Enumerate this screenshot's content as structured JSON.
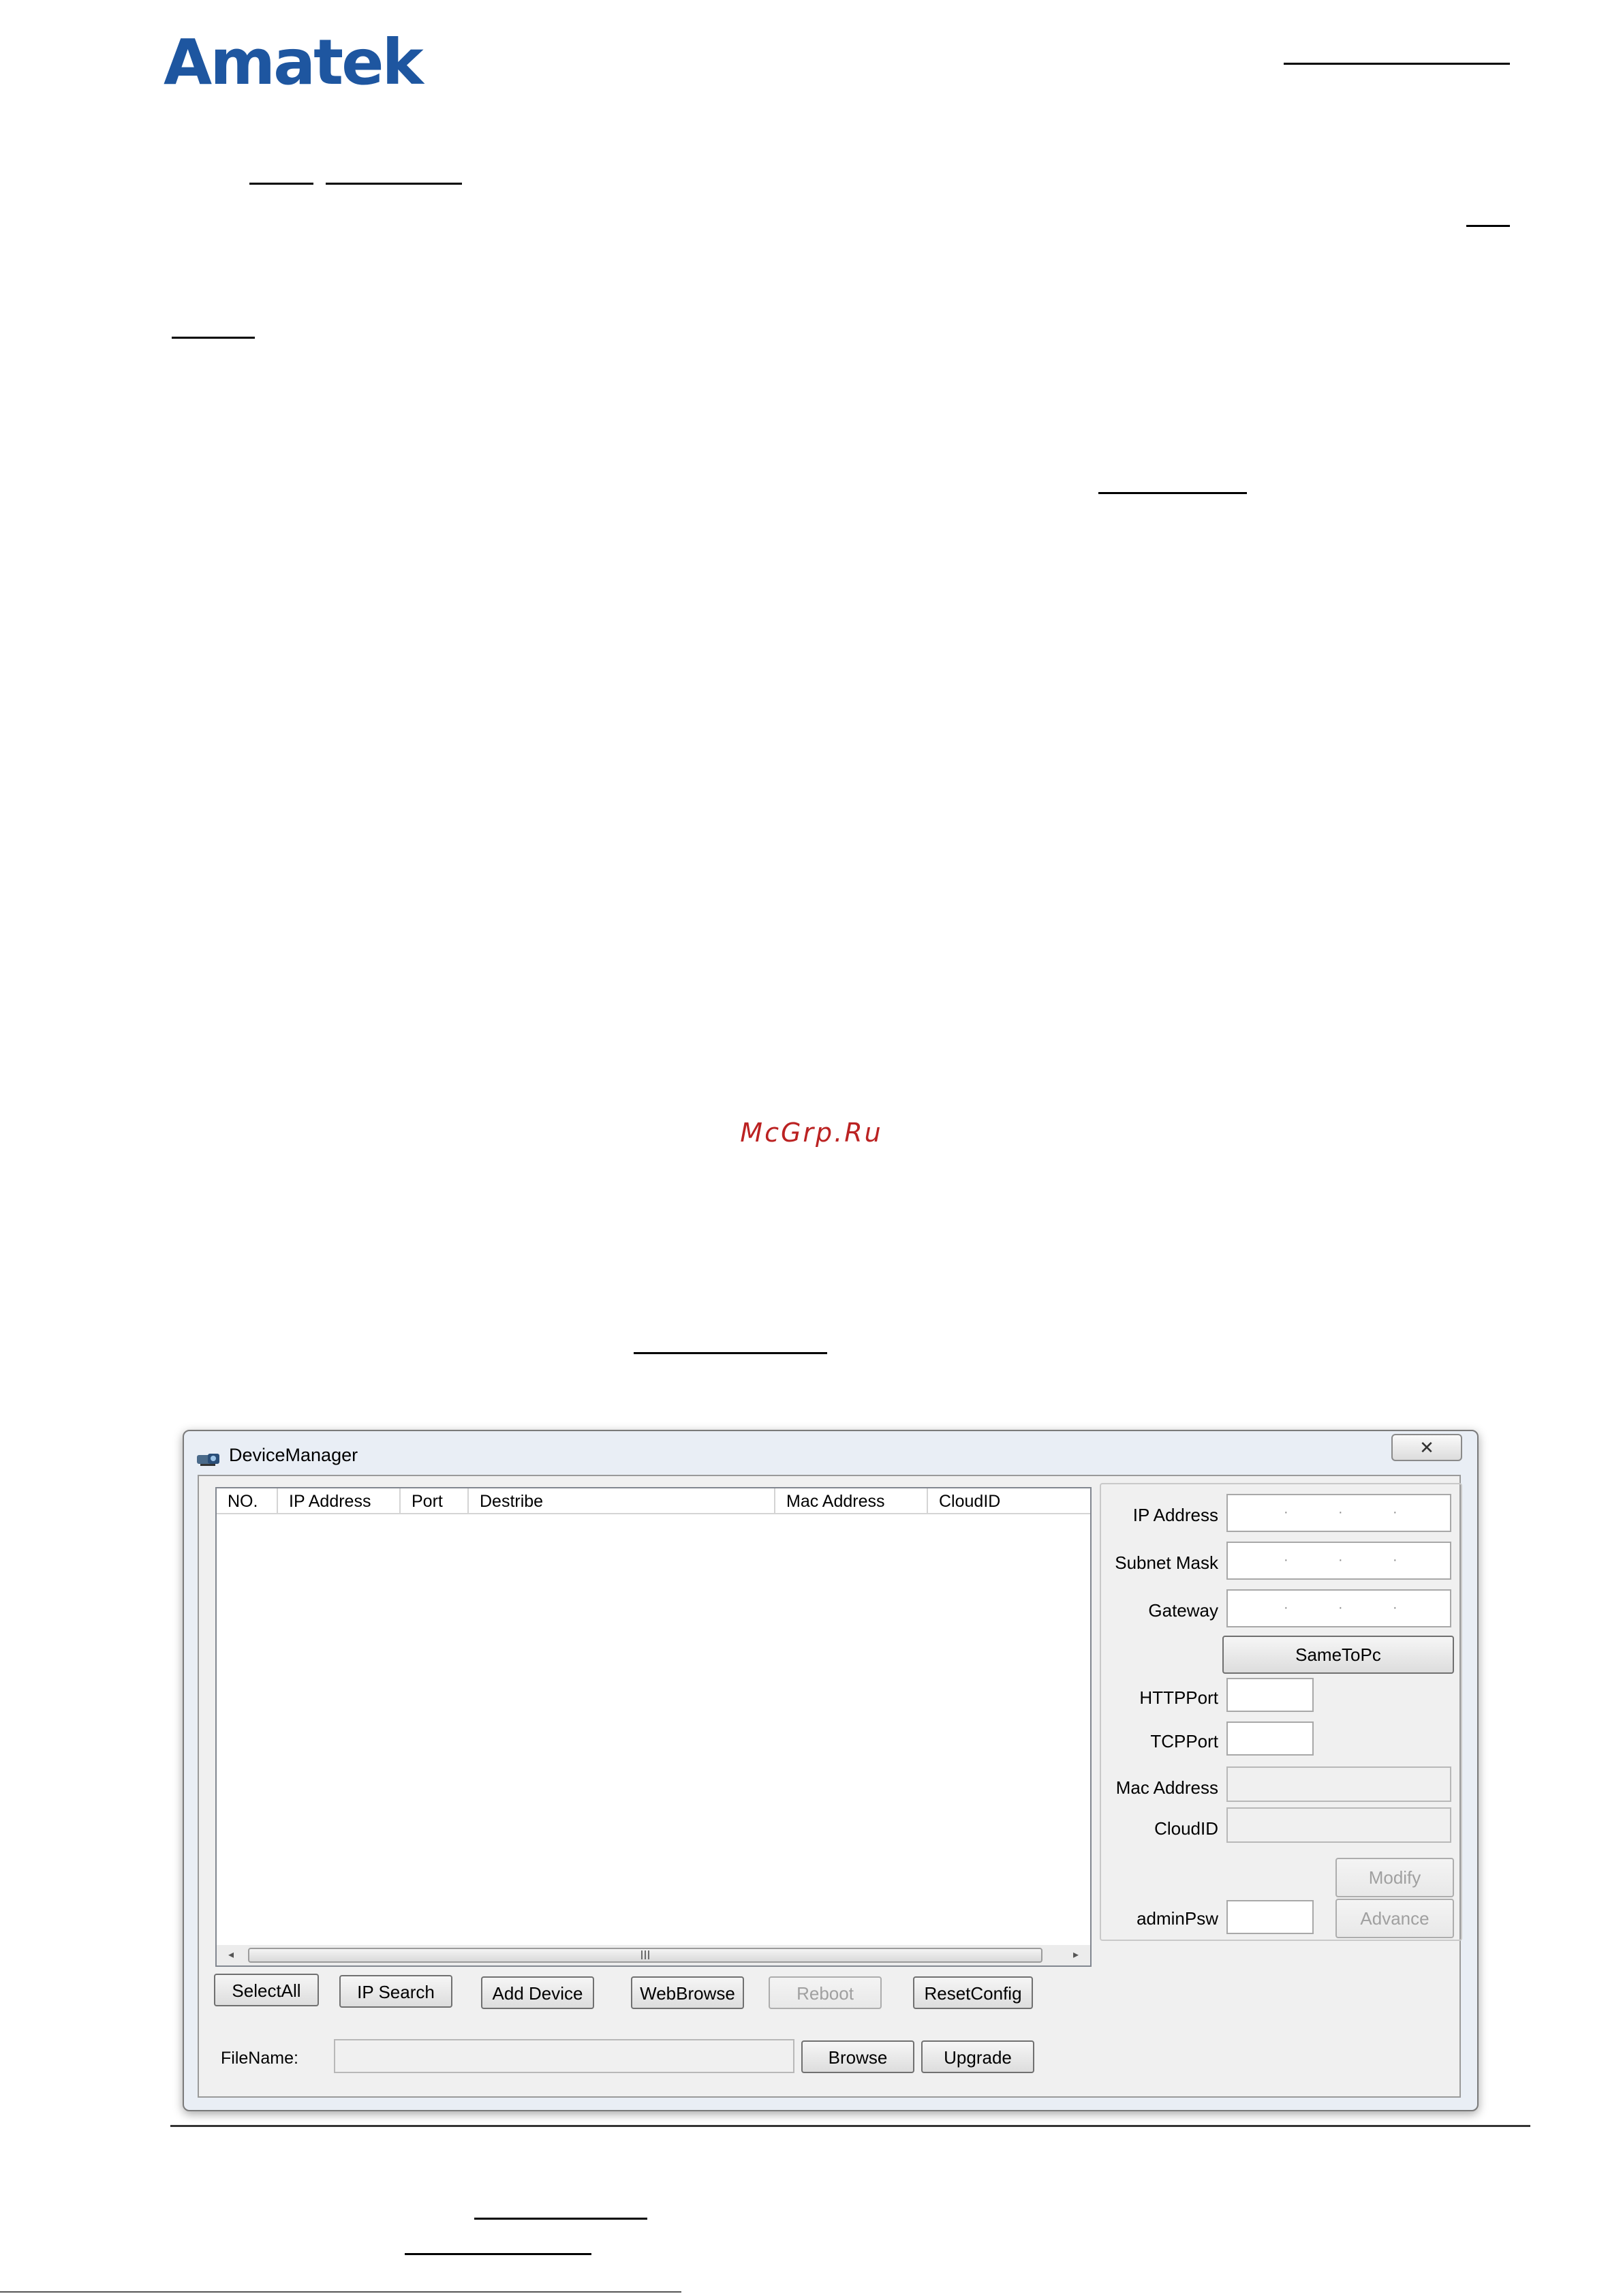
{
  "brand": {
    "logo_text": "Amatek"
  },
  "watermark": "McGrp.Ru",
  "window": {
    "title": "DeviceManager",
    "close_glyph": "✕",
    "list": {
      "columns": [
        "NO.",
        "IP Address",
        "Port",
        "Destribe",
        "Mac Address",
        "CloudID"
      ],
      "scroll_left": "◂",
      "scroll_right": "▸",
      "scroll_grip": "III"
    },
    "buttons": {
      "select_all": "SelectAll",
      "ip_search": "IP Search",
      "add_device": "Add Device",
      "web_browse": "WebBrowse",
      "reboot": "Reboot",
      "reset_config": "ResetConfig",
      "browse": "Browse",
      "upgrade": "Upgrade",
      "same_to_pc": "SameToPc",
      "modify": "Modify",
      "advance": "Advance"
    },
    "filename_label": "FileName:",
    "config": {
      "ip_address_label": "IP Address",
      "subnet_mask_label": "Subnet Mask",
      "gateway_label": "Gateway",
      "http_port_label": "HTTPPort",
      "tcp_port_label": "TCPPort",
      "mac_address_label": "Mac Address",
      "cloud_id_label": "CloudID",
      "admin_psw_label": "adminPsw",
      "ip_dot": "·"
    }
  },
  "colors": {
    "logo": "#1e56a0",
    "watermark": "#bb2222",
    "window_bg": "#f0f0f0",
    "default_button_border": "#2f6fb7"
  }
}
